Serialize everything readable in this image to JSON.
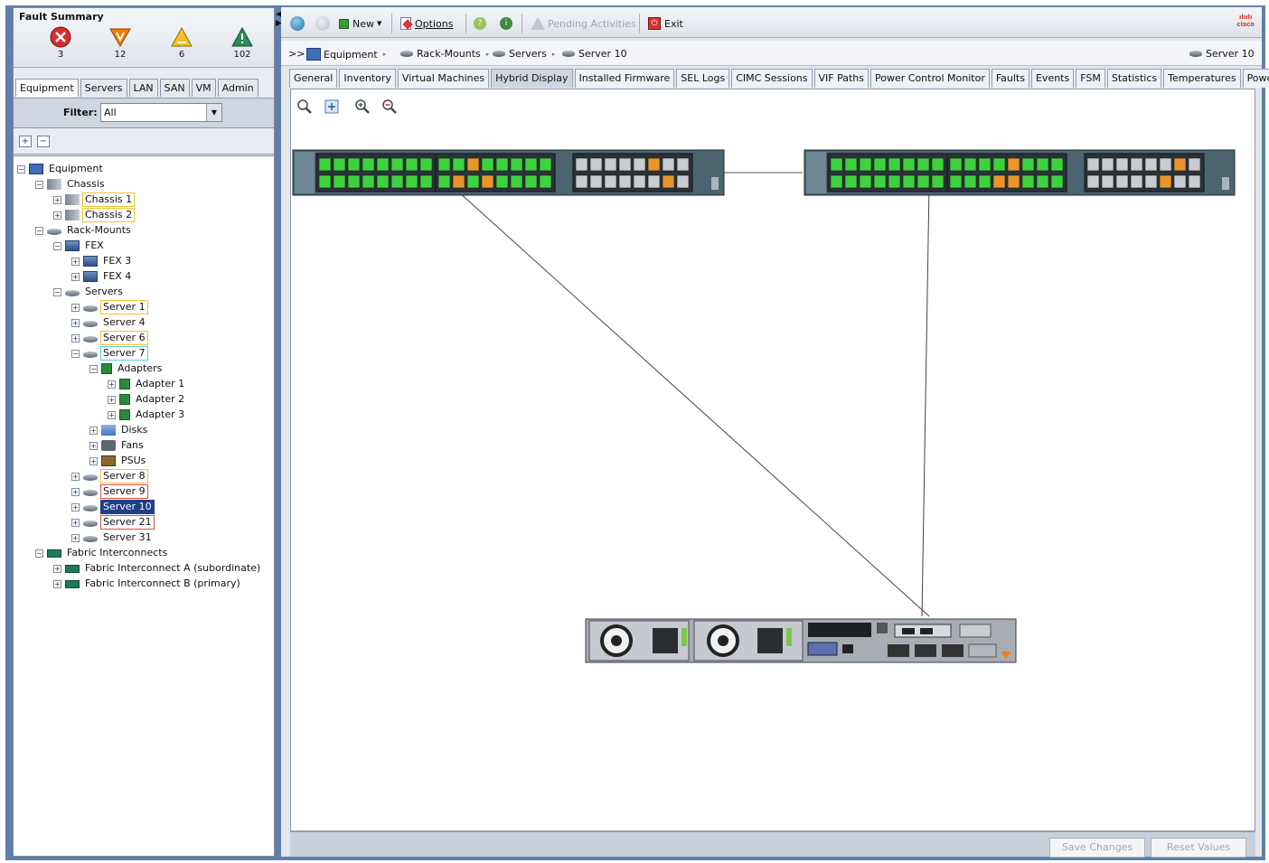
{
  "fault_summary": {
    "title": "Fault Summary",
    "items": [
      {
        "name": "critical",
        "count": "3",
        "color": "#d32f2f"
      },
      {
        "name": "major",
        "count": "12",
        "color": "#f57c00"
      },
      {
        "name": "minor",
        "count": "6",
        "color": "#f6c025"
      },
      {
        "name": "warning",
        "count": "102",
        "color": "#2e8b57"
      }
    ]
  },
  "nav_tabs": [
    "Equipment",
    "Servers",
    "LAN",
    "SAN",
    "VM",
    "Admin"
  ],
  "filter": {
    "label": "Filter:",
    "value": "All"
  },
  "tree": {
    "equipment": "Equipment",
    "chassis": "Chassis",
    "chassis1": "Chassis 1",
    "chassis2": "Chassis 2",
    "rackmounts": "Rack-Mounts",
    "fex": "FEX",
    "fex3": "FEX 3",
    "fex4": "FEX 4",
    "servers": "Servers",
    "server1": "Server 1",
    "server4": "Server 4",
    "server6": "Server 6",
    "server7": "Server 7",
    "adapters": "Adapters",
    "adapter1": "Adapter 1",
    "adapter2": "Adapter 2",
    "adapter3": "Adapter 3",
    "disks": "Disks",
    "fans": "Fans",
    "psus": "PSUs",
    "server8": "Server 8",
    "server9": "Server 9",
    "server10": "Server 10",
    "server21": "Server 21",
    "server31": "Server 31",
    "fabric": "Fabric Interconnects",
    "fiA": "Fabric Interconnect A (subordinate)",
    "fiB": "Fabric Interconnect B (primary)"
  },
  "toolbar": {
    "new": "New",
    "options": "Options",
    "pending": "Pending Activities",
    "exit": "Exit"
  },
  "breadcrumb": {
    "prefix": ">>",
    "items": [
      "Equipment",
      "Rack-Mounts",
      "Servers",
      "Server 10"
    ],
    "current": "Server 10"
  },
  "tabs": [
    "General",
    "Inventory",
    "Virtual Machines",
    "Hybrid Display",
    "Installed Firmware",
    "SEL Logs",
    "CIMC Sessions",
    "VIF Paths",
    "Power Control Monitor",
    "Faults",
    "Events",
    "FSM",
    "Statistics",
    "Temperatures",
    "Power"
  ],
  "active_tab": "Hybrid Display",
  "footer": {
    "save": "Save Changes",
    "reset": "Reset Values"
  },
  "colors": {
    "port_green": "#3fd23f",
    "port_orange": "#e8962a",
    "selected": "#1f3f87",
    "accent": "#5f7fa8"
  }
}
